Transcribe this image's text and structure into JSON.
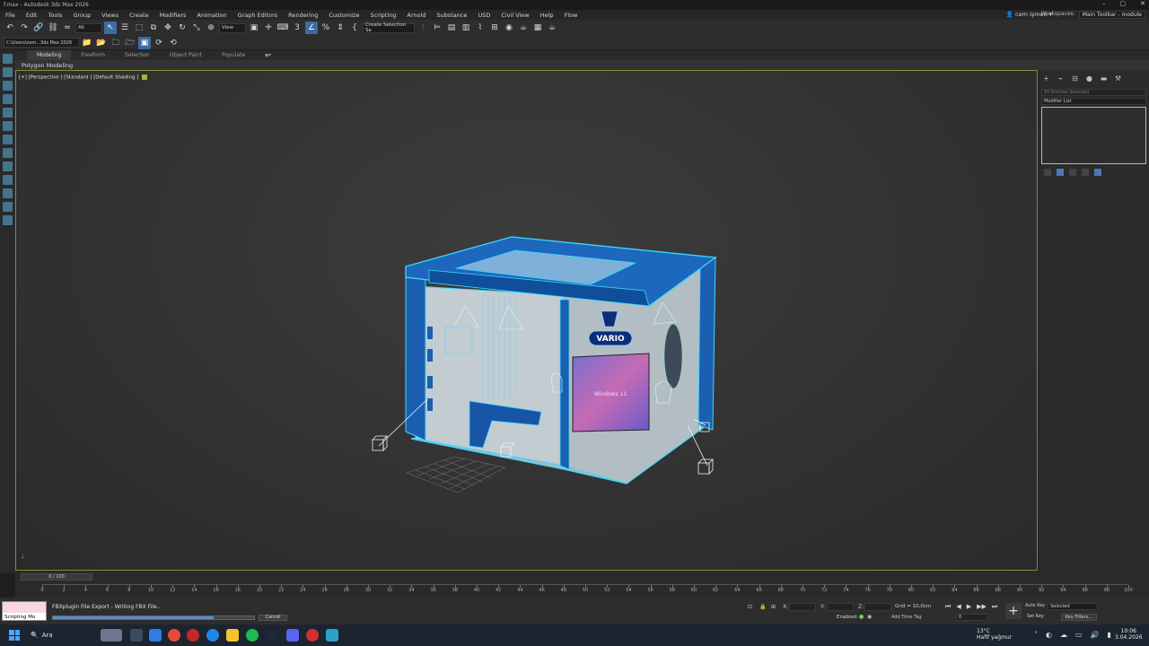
{
  "title": "f.max - Autodesk 3ds Max 2026",
  "menus": [
    "File",
    "Edit",
    "Tools",
    "Group",
    "Views",
    "Create",
    "Modifiers",
    "Animation",
    "Graph Editors",
    "Rendering",
    "Customize",
    "Scripting",
    "Arnold",
    "Substance",
    "USD",
    "Civil View",
    "Help",
    "Flow"
  ],
  "user": "cem işmen",
  "workspace": {
    "label": "Workspaces:",
    "value": "Main Toolbar - module"
  },
  "toolbar": {
    "filter_value": "All",
    "ref_coord": "View",
    "selection_set": "Create Selection Se"
  },
  "path": "C:\\Users\\cem...3ds Max 2026",
  "ribbon": {
    "tabs": [
      "Modeling",
      "Freeform",
      "Selection",
      "Object Paint",
      "Populate"
    ],
    "panel_label": "Polygon Modeling"
  },
  "viewport": {
    "label": "[+] [Perspective ] [Standard ] [Default Shading ]",
    "sign_text": "VARIO",
    "screen_text": "Windows 11"
  },
  "command_panel": {
    "selection": "50 Entities Selected",
    "modifier_list": "Modifier List"
  },
  "timeline": {
    "slider_label": "0 / 100",
    "ticks": [
      0,
      2,
      4,
      6,
      8,
      10,
      12,
      14,
      16,
      18,
      20,
      22,
      24,
      26,
      28,
      30,
      32,
      34,
      36,
      38,
      40,
      42,
      44,
      46,
      48,
      50,
      52,
      54,
      56,
      58,
      60,
      62,
      64,
      66,
      68,
      70,
      72,
      74,
      76,
      78,
      80,
      82,
      84,
      86,
      88,
      90,
      92,
      94,
      96,
      98,
      100
    ]
  },
  "status": {
    "script_label": "Scripting Mo",
    "message": "FBXplugin File Export - Writing FBX File..",
    "progress": 0.8,
    "cancel": "Cancel",
    "x_label": "X:",
    "y_label": "Y:",
    "z_label": "Z:",
    "grid": "Grid = 10,0cm",
    "enabled": "Enabled:",
    "add_time_tag": "Add Time Tag",
    "auto_key": "Auto Key",
    "set_key": "Set Key",
    "selected": "Selected",
    "key_filters": "Key Filters...",
    "frame": "0"
  },
  "taskbar": {
    "search": "Ara",
    "weather_temp": "13°C",
    "weather_desc": "Hafif yağmur",
    "time": "10:06",
    "date": "3.04.2026"
  }
}
